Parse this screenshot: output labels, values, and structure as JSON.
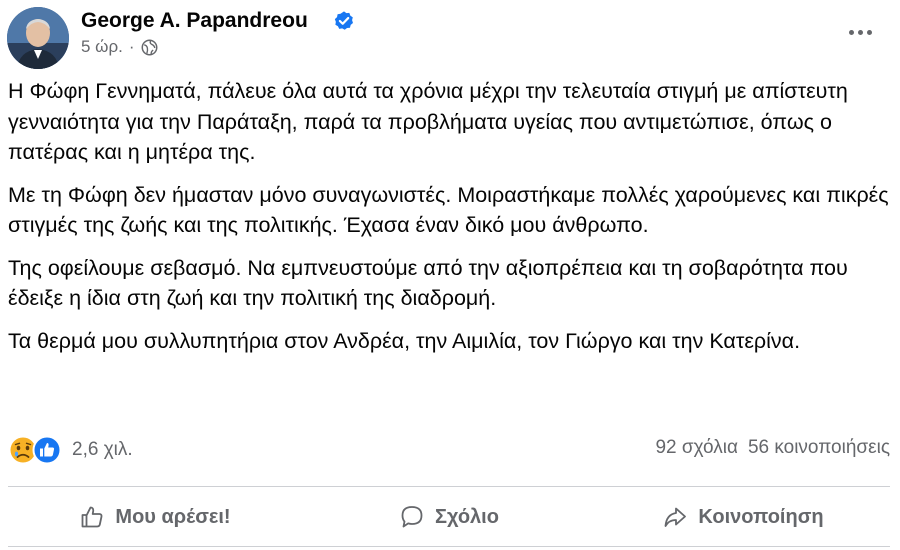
{
  "post": {
    "author": "George A. Papandreou",
    "verified_icon": "verified-badge-icon",
    "time": "5 ώρ.",
    "separator": "·",
    "audience_icon": "globe-icon",
    "more_icon": "more-options-icon",
    "paragraphs": [
      "Η Φώφη Γεννηματά, πάλευε όλα αυτά τα χρόνια μέχρι την τελευταία στιγμή με απίστευτη γενναιότητα για την Παράταξη, παρά τα προβλήματα υγείας που αντιμετώπισε, όπως ο πατέρας και η μητέρα της.",
      "Με τη Φώφη δεν ήμασταν μόνο συναγωνιστές. Μοιραστήκαμε  πολλές χαρούμενες και πικρές στιγμές της ζωής και της πολιτικής. Έχασα έναν δικό μου άνθρωπο.",
      "Της οφείλουμε σεβασμό. Να εμπνευστούμε από την αξιοπρέπεια και τη σοβαρότητα που έδειξε η ίδια στη ζωή και την πολιτική της διαδρομή.",
      "Τα θερμά μου συλλυπητήρια στον Ανδρέα, την Αιμιλία, τον Γιώργο και την Κατερίνα."
    ]
  },
  "engagement": {
    "reaction_icons": [
      "sad-reaction-icon",
      "like-reaction-icon"
    ],
    "reaction_count": "2,6 χιλ.",
    "comments": "92 σχόλια",
    "shares": "56 κοινοποιήσεις"
  },
  "actions": {
    "like": {
      "label": "Μου αρέσει!",
      "icon": "thumbs-up-icon"
    },
    "comment": {
      "label": "Σχόλιο",
      "icon": "comment-icon"
    },
    "share": {
      "label": "Κοινοποίηση",
      "icon": "share-icon"
    }
  },
  "colors": {
    "verified": "#1877f2",
    "secondary_text": "#65676b",
    "divider": "#ced0d4",
    "like_reaction": "#1877f2",
    "sad_reaction": "#f7b125"
  }
}
